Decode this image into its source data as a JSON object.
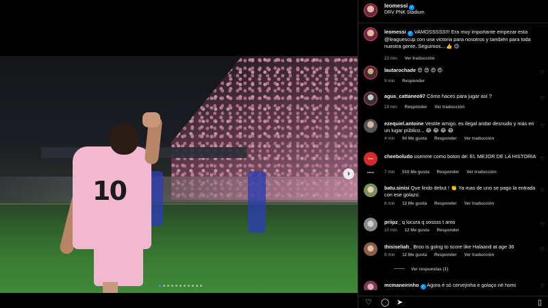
{
  "post": {
    "username": "leomessi",
    "location": "DRV PNK Stadium",
    "caption_user": "leomessi",
    "caption_text": "VAMOSSSSS!!! Era muy importante empezar esta @leaguescup con una victoria para nosotros y también para toda nuestra gente. Seguimos... 👍 😉",
    "caption_time": "23 min",
    "caption_translate": "Ver traducción",
    "player_number": "10"
  },
  "comments": [
    {
      "user": "lautarochade",
      "text": "😍 😍 😍 😍",
      "time": "9 min",
      "likes": "",
      "reply": "Responder",
      "translate": ""
    },
    {
      "user": "agus_cattaneo97",
      "text": "Cómo haces para jugar así ?",
      "time": "19 min",
      "likes": "",
      "reply": "Responder",
      "translate": "Ver traducción"
    },
    {
      "user": "ezequiel.antoine",
      "text": "Vestite amigo, es ilegal andar desnudo y más en un lugar público... 😂 😂 😂 😂",
      "time": "4 min",
      "likes": "94 Me gusta",
      "reply": "Responder",
      "translate": "Ver traducción"
    },
    {
      "user": "cheeboludo",
      "text": "usenme como boton de: EL MEJOR DE LA HISTORIA",
      "time": "7 min",
      "likes": "516 Me gusta",
      "reply": "Responder",
      "translate": "Ver traducción",
      "avatar_text": "Ohee boludo"
    },
    {
      "user": "batu.sinisi",
      "text": "Que lindo debut ! 👏 Ya mas de uno se pago la entrada con ese golazo.",
      "time": "8 min",
      "likes": "12 Me gusta",
      "reply": "Responder",
      "translate": "Ver traducción"
    },
    {
      "user": "priipz_",
      "text": "q locura q sossss t amo",
      "time": "10 min",
      "likes": "12 Me gusta",
      "reply": "Responder",
      "translate": ""
    },
    {
      "user": "thisiseliah_",
      "text": "Broo is going to score like Halaand at age 36",
      "time": "9 min",
      "likes": "12 Me gusta",
      "reply": "Responder",
      "translate": "Ver traducción",
      "view_replies": "Ver respuestas (1)"
    },
    {
      "user": "mcmaneirinho",
      "text": "Agora é só cervejinha e golaço né homi",
      "time": "",
      "likes": "",
      "reply": "",
      "translate": ""
    }
  ],
  "icons": {
    "like": "heart-icon",
    "comment": "comment-icon",
    "share": "share-icon",
    "save": "bookmark-icon",
    "next": "chevron-right-icon"
  },
  "colors": {
    "verified": "#0095f6",
    "jersey": "#f1b8cf",
    "active_dot": "#3897f0"
  }
}
